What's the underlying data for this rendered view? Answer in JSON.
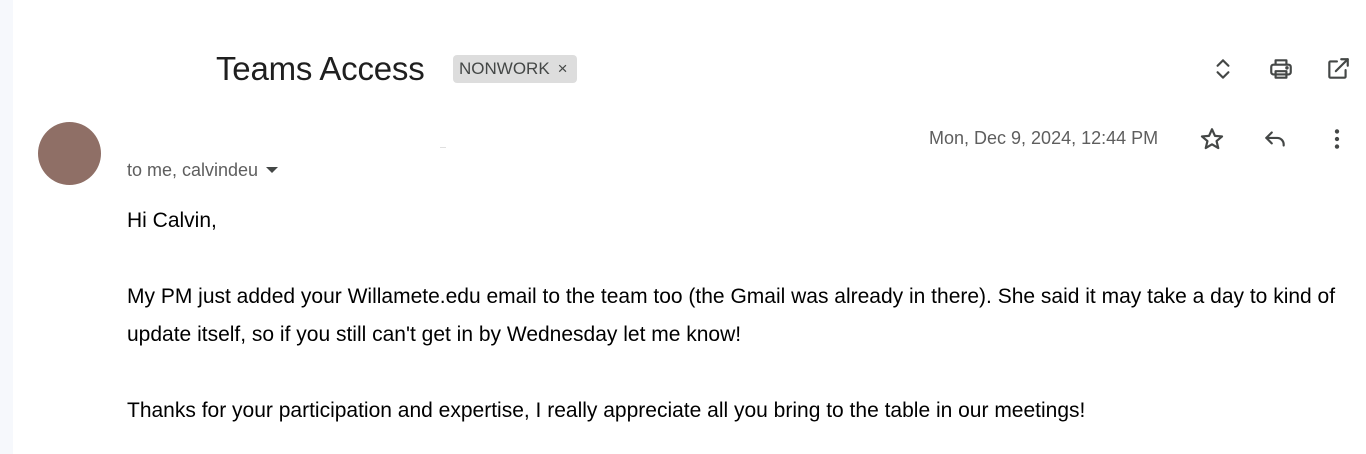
{
  "email": {
    "subject": "Teams Access",
    "label": "NONWORK",
    "label_remove": "×",
    "recipients": "to me, calvindeu",
    "date": "Mon, Dec 9, 2024, 12:44 PM",
    "body": {
      "greeting": "Hi Calvin,",
      "paragraph1": "My PM just added your Willamete.edu email to the team too (the Gmail was already in there). She said it may take a day to kind of update itself, so if you still can't get in by Wednesday let me know!",
      "paragraph2": "Thanks for your participation and expertise, I really appreciate all you bring to the table in our meetings!"
    }
  },
  "icons": {
    "expand": "unfold-icon",
    "print": "print-icon",
    "open_new_window": "open-in-new-icon",
    "star": "star-icon",
    "reply": "reply-icon",
    "more": "more-vert-icon"
  },
  "colors": {
    "avatar": "#8f6f66",
    "chip_bg": "#dddddd",
    "icon": "#444746"
  }
}
